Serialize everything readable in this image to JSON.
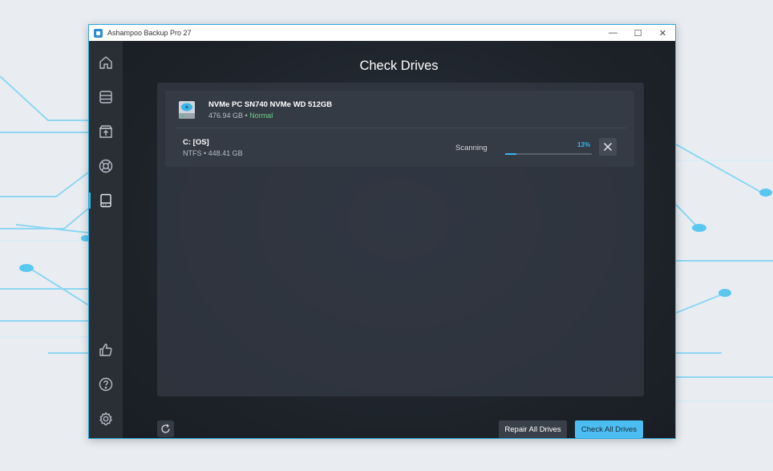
{
  "window": {
    "title": "Ashampoo Backup Pro 27",
    "minimize": "—",
    "maximize": "☐",
    "close": "✕"
  },
  "sidebar": {
    "items": [
      {
        "icon": "home-icon"
      },
      {
        "icon": "backups-icon"
      },
      {
        "icon": "restore-icon"
      },
      {
        "icon": "rescue-icon"
      },
      {
        "icon": "drive-check-icon",
        "active": true
      },
      {
        "icon": "thumbs-up-icon"
      },
      {
        "icon": "help-icon"
      },
      {
        "icon": "settings-icon"
      }
    ]
  },
  "main": {
    "title": "Check Drives",
    "drive": {
      "name": "NVMe PC SN740 NVMe WD 512GB",
      "size": "476.94 GB",
      "separator": " • ",
      "status": "Normal",
      "partition": {
        "name": "C: [OS]",
        "details": "NTFS • 448.41 GB",
        "state": "Scanning",
        "progress_label": "13%",
        "progress": 13
      }
    },
    "buttons": {
      "repair_all": "Repair All Drives",
      "check_all": "Check All Drives"
    }
  },
  "colors": {
    "accent": "#38b6f1",
    "status_ok": "#6fd08c"
  }
}
